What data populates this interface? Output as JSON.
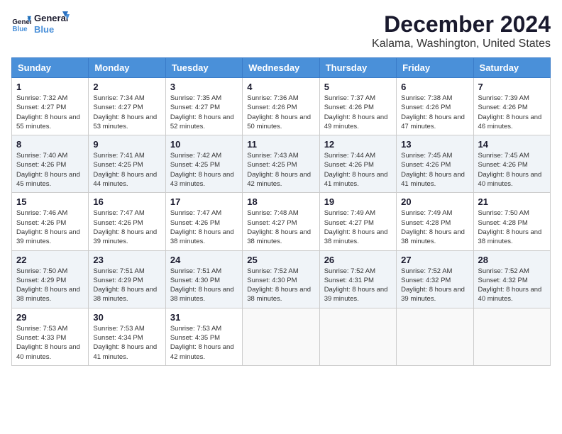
{
  "header": {
    "logo_line1": "General",
    "logo_line2": "Blue",
    "month": "December 2024",
    "location": "Kalama, Washington, United States"
  },
  "weekdays": [
    "Sunday",
    "Monday",
    "Tuesday",
    "Wednesday",
    "Thursday",
    "Friday",
    "Saturday"
  ],
  "weeks": [
    [
      {
        "day": "1",
        "sunrise": "7:32 AM",
        "sunset": "4:27 PM",
        "daylight": "8 hours and 55 minutes."
      },
      {
        "day": "2",
        "sunrise": "7:34 AM",
        "sunset": "4:27 PM",
        "daylight": "8 hours and 53 minutes."
      },
      {
        "day": "3",
        "sunrise": "7:35 AM",
        "sunset": "4:27 PM",
        "daylight": "8 hours and 52 minutes."
      },
      {
        "day": "4",
        "sunrise": "7:36 AM",
        "sunset": "4:26 PM",
        "daylight": "8 hours and 50 minutes."
      },
      {
        "day": "5",
        "sunrise": "7:37 AM",
        "sunset": "4:26 PM",
        "daylight": "8 hours and 49 minutes."
      },
      {
        "day": "6",
        "sunrise": "7:38 AM",
        "sunset": "4:26 PM",
        "daylight": "8 hours and 47 minutes."
      },
      {
        "day": "7",
        "sunrise": "7:39 AM",
        "sunset": "4:26 PM",
        "daylight": "8 hours and 46 minutes."
      }
    ],
    [
      {
        "day": "8",
        "sunrise": "7:40 AM",
        "sunset": "4:26 PM",
        "daylight": "8 hours and 45 minutes."
      },
      {
        "day": "9",
        "sunrise": "7:41 AM",
        "sunset": "4:25 PM",
        "daylight": "8 hours and 44 minutes."
      },
      {
        "day": "10",
        "sunrise": "7:42 AM",
        "sunset": "4:25 PM",
        "daylight": "8 hours and 43 minutes."
      },
      {
        "day": "11",
        "sunrise": "7:43 AM",
        "sunset": "4:25 PM",
        "daylight": "8 hours and 42 minutes."
      },
      {
        "day": "12",
        "sunrise": "7:44 AM",
        "sunset": "4:26 PM",
        "daylight": "8 hours and 41 minutes."
      },
      {
        "day": "13",
        "sunrise": "7:45 AM",
        "sunset": "4:26 PM",
        "daylight": "8 hours and 41 minutes."
      },
      {
        "day": "14",
        "sunrise": "7:45 AM",
        "sunset": "4:26 PM",
        "daylight": "8 hours and 40 minutes."
      }
    ],
    [
      {
        "day": "15",
        "sunrise": "7:46 AM",
        "sunset": "4:26 PM",
        "daylight": "8 hours and 39 minutes."
      },
      {
        "day": "16",
        "sunrise": "7:47 AM",
        "sunset": "4:26 PM",
        "daylight": "8 hours and 39 minutes."
      },
      {
        "day": "17",
        "sunrise": "7:47 AM",
        "sunset": "4:26 PM",
        "daylight": "8 hours and 38 minutes."
      },
      {
        "day": "18",
        "sunrise": "7:48 AM",
        "sunset": "4:27 PM",
        "daylight": "8 hours and 38 minutes."
      },
      {
        "day": "19",
        "sunrise": "7:49 AM",
        "sunset": "4:27 PM",
        "daylight": "8 hours and 38 minutes."
      },
      {
        "day": "20",
        "sunrise": "7:49 AM",
        "sunset": "4:28 PM",
        "daylight": "8 hours and 38 minutes."
      },
      {
        "day": "21",
        "sunrise": "7:50 AM",
        "sunset": "4:28 PM",
        "daylight": "8 hours and 38 minutes."
      }
    ],
    [
      {
        "day": "22",
        "sunrise": "7:50 AM",
        "sunset": "4:29 PM",
        "daylight": "8 hours and 38 minutes."
      },
      {
        "day": "23",
        "sunrise": "7:51 AM",
        "sunset": "4:29 PM",
        "daylight": "8 hours and 38 minutes."
      },
      {
        "day": "24",
        "sunrise": "7:51 AM",
        "sunset": "4:30 PM",
        "daylight": "8 hours and 38 minutes."
      },
      {
        "day": "25",
        "sunrise": "7:52 AM",
        "sunset": "4:30 PM",
        "daylight": "8 hours and 38 minutes."
      },
      {
        "day": "26",
        "sunrise": "7:52 AM",
        "sunset": "4:31 PM",
        "daylight": "8 hours and 39 minutes."
      },
      {
        "day": "27",
        "sunrise": "7:52 AM",
        "sunset": "4:32 PM",
        "daylight": "8 hours and 39 minutes."
      },
      {
        "day": "28",
        "sunrise": "7:52 AM",
        "sunset": "4:32 PM",
        "daylight": "8 hours and 40 minutes."
      }
    ],
    [
      {
        "day": "29",
        "sunrise": "7:53 AM",
        "sunset": "4:33 PM",
        "daylight": "8 hours and 40 minutes."
      },
      {
        "day": "30",
        "sunrise": "7:53 AM",
        "sunset": "4:34 PM",
        "daylight": "8 hours and 41 minutes."
      },
      {
        "day": "31",
        "sunrise": "7:53 AM",
        "sunset": "4:35 PM",
        "daylight": "8 hours and 42 minutes."
      },
      null,
      null,
      null,
      null
    ]
  ],
  "labels": {
    "sunrise": "Sunrise: ",
    "sunset": "Sunset: ",
    "daylight": "Daylight: "
  }
}
